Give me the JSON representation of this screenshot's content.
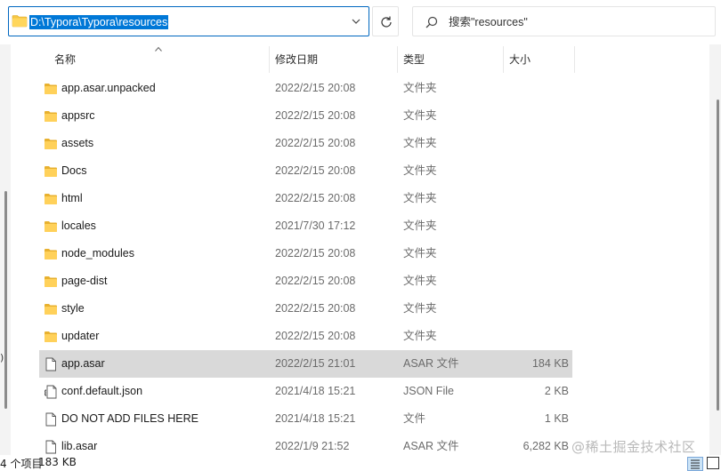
{
  "address_bar": {
    "path": "D:\\Typora\\Typora\\resources"
  },
  "search": {
    "placeholder": "搜索\"resources\""
  },
  "columns": {
    "name": "名称",
    "date": "修改日期",
    "type": "类型",
    "size": "大小"
  },
  "files": [
    {
      "name": "app.asar.unpacked",
      "date": "2022/2/15 20:08",
      "type": "文件夹",
      "size": "",
      "icon": "folder-icon"
    },
    {
      "name": "appsrc",
      "date": "2022/2/15 20:08",
      "type": "文件夹",
      "size": "",
      "icon": "folder-icon"
    },
    {
      "name": "assets",
      "date": "2022/2/15 20:08",
      "type": "文件夹",
      "size": "",
      "icon": "folder-icon"
    },
    {
      "name": "Docs",
      "date": "2022/2/15 20:08",
      "type": "文件夹",
      "size": "",
      "icon": "folder-icon"
    },
    {
      "name": "html",
      "date": "2022/2/15 20:08",
      "type": "文件夹",
      "size": "",
      "icon": "folder-icon"
    },
    {
      "name": "locales",
      "date": "2021/7/30 17:12",
      "type": "文件夹",
      "size": "",
      "icon": "folder-icon"
    },
    {
      "name": "node_modules",
      "date": "2022/2/15 20:08",
      "type": "文件夹",
      "size": "",
      "icon": "folder-icon"
    },
    {
      "name": "page-dist",
      "date": "2022/2/15 20:08",
      "type": "文件夹",
      "size": "",
      "icon": "folder-icon"
    },
    {
      "name": "style",
      "date": "2022/2/15 20:08",
      "type": "文件夹",
      "size": "",
      "icon": "folder-icon"
    },
    {
      "name": "updater",
      "date": "2022/2/15 20:08",
      "type": "文件夹",
      "size": "",
      "icon": "folder-icon"
    },
    {
      "name": "app.asar",
      "date": "2022/2/15 21:01",
      "type": "ASAR 文件",
      "size": "184 KB",
      "icon": "file-icon",
      "selected": true
    },
    {
      "name": "conf.default.json",
      "date": "2021/4/18 15:21",
      "type": "JSON File",
      "size": "2 KB",
      "icon": "json-file-icon"
    },
    {
      "name": "DO NOT ADD FILES HERE",
      "date": "2021/4/18 15:21",
      "type": "文件",
      "size": "1 KB",
      "icon": "file-icon"
    },
    {
      "name": "lib.asar",
      "date": "2022/1/9 21:52",
      "type": "ASAR 文件",
      "size": "6,282 KB",
      "icon": "file-icon"
    }
  ],
  "status_bar": {
    "item_count": "4 个项目",
    "selection_size": "183 KB"
  },
  "left_pane_cut_text": ")",
  "watermark": "@稀土掘金技术社区",
  "colors": {
    "accent": "#0067c0",
    "selection_highlight": "#0078d7",
    "selected_row": "#d9d9d9",
    "folder": "#f6c643"
  }
}
